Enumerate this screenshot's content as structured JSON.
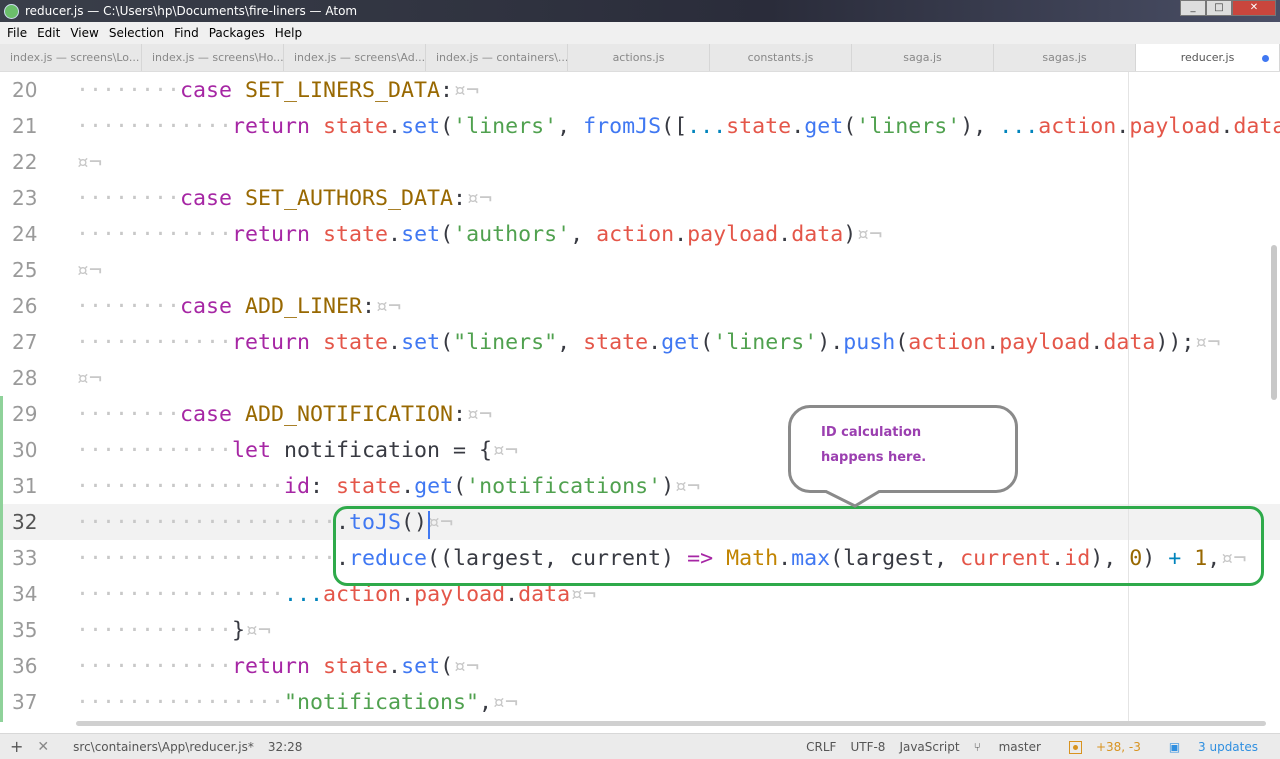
{
  "window": {
    "title": "reducer.js — C:\\Users\\hp\\Documents\\fire-liners — Atom"
  },
  "menu": [
    "File",
    "Edit",
    "View",
    "Selection",
    "Find",
    "Packages",
    "Help"
  ],
  "tabs": [
    "index.js — screens\\Lo...",
    "index.js — screens\\Ho...",
    "index.js — screens\\Ad...",
    "index.js — containers\\...",
    "actions.js",
    "constants.js",
    "saga.js",
    "sagas.js",
    "reducer.js"
  ],
  "colors": {
    "accent": "#4078f2",
    "annotation_box": "#2eaa4a",
    "annotation_text": "#9b3fb0"
  },
  "code": {
    "lines": [
      {
        "n": "20",
        "t": [
          [
            "········",
            "ws"
          ],
          [
            "case ",
            "kw"
          ],
          [
            "SET_LINERS_DATA",
            "cn"
          ],
          [
            ":",
            "pl"
          ],
          [
            "¤¬",
            "ws"
          ]
        ]
      },
      {
        "n": "21",
        "t": [
          [
            "············",
            "ws"
          ],
          [
            "return ",
            "kw"
          ],
          [
            "state",
            "vr"
          ],
          [
            ".",
            "pl"
          ],
          [
            "set",
            "fn"
          ],
          [
            "(",
            "pl"
          ],
          [
            "'liners'",
            "st"
          ],
          [
            ", ",
            "pl"
          ],
          [
            "fromJS",
            "fn"
          ],
          [
            "([",
            "pl"
          ],
          [
            "...",
            "op"
          ],
          [
            "state",
            "vr"
          ],
          [
            ".",
            "pl"
          ],
          [
            "get",
            "fn"
          ],
          [
            "(",
            "pl"
          ],
          [
            "'liners'",
            "st"
          ],
          [
            "), ",
            "pl"
          ],
          [
            "...",
            "op"
          ],
          [
            "action",
            "vr"
          ],
          [
            ".",
            "pl"
          ],
          [
            "payload",
            "vr"
          ],
          [
            ".",
            "pl"
          ],
          [
            "data",
            "vr"
          ]
        ]
      },
      {
        "n": "22",
        "t": [
          [
            "¤¬",
            "ws"
          ]
        ]
      },
      {
        "n": "23",
        "t": [
          [
            "········",
            "ws"
          ],
          [
            "case ",
            "kw"
          ],
          [
            "SET_AUTHORS_DATA",
            "cn"
          ],
          [
            ":",
            "pl"
          ],
          [
            "¤¬",
            "ws"
          ]
        ]
      },
      {
        "n": "24",
        "t": [
          [
            "············",
            "ws"
          ],
          [
            "return ",
            "kw"
          ],
          [
            "state",
            "vr"
          ],
          [
            ".",
            "pl"
          ],
          [
            "set",
            "fn"
          ],
          [
            "(",
            "pl"
          ],
          [
            "'authors'",
            "st"
          ],
          [
            ", ",
            "pl"
          ],
          [
            "action",
            "vr"
          ],
          [
            ".",
            "pl"
          ],
          [
            "payload",
            "vr"
          ],
          [
            ".",
            "pl"
          ],
          [
            "data",
            "vr"
          ],
          [
            ")",
            "pl"
          ],
          [
            "¤¬",
            "ws"
          ]
        ]
      },
      {
        "n": "25",
        "t": [
          [
            "¤¬",
            "ws"
          ]
        ]
      },
      {
        "n": "26",
        "t": [
          [
            "········",
            "ws"
          ],
          [
            "case ",
            "kw"
          ],
          [
            "ADD_LINER",
            "cn"
          ],
          [
            ":",
            "pl"
          ],
          [
            "¤¬",
            "ws"
          ]
        ]
      },
      {
        "n": "27",
        "t": [
          [
            "············",
            "ws"
          ],
          [
            "return ",
            "kw"
          ],
          [
            "state",
            "vr"
          ],
          [
            ".",
            "pl"
          ],
          [
            "set",
            "fn"
          ],
          [
            "(",
            "pl"
          ],
          [
            "\"liners\"",
            "st"
          ],
          [
            ", ",
            "pl"
          ],
          [
            "state",
            "vr"
          ],
          [
            ".",
            "pl"
          ],
          [
            "get",
            "fn"
          ],
          [
            "(",
            "pl"
          ],
          [
            "'liners'",
            "st"
          ],
          [
            ").",
            "pl"
          ],
          [
            "push",
            "fn"
          ],
          [
            "(",
            "pl"
          ],
          [
            "action",
            "vr"
          ],
          [
            ".",
            "pl"
          ],
          [
            "payload",
            "vr"
          ],
          [
            ".",
            "pl"
          ],
          [
            "data",
            "vr"
          ],
          [
            "));",
            "pl"
          ],
          [
            "¤¬",
            "ws"
          ]
        ]
      },
      {
        "n": "28",
        "t": [
          [
            "¤¬",
            "ws"
          ]
        ]
      },
      {
        "n": "29",
        "t": [
          [
            "········",
            "ws"
          ],
          [
            "case ",
            "kw"
          ],
          [
            "ADD_NOTIFICATION",
            "cn"
          ],
          [
            ":",
            "pl"
          ],
          [
            "¤¬",
            "ws"
          ]
        ]
      },
      {
        "n": "30",
        "t": [
          [
            "············",
            "ws"
          ],
          [
            "let ",
            "kw"
          ],
          [
            "notification = {",
            "pl"
          ],
          [
            "¤¬",
            "ws"
          ]
        ]
      },
      {
        "n": "31",
        "t": [
          [
            "················",
            "ws"
          ],
          [
            "id",
            "kw"
          ],
          [
            ": ",
            "pl"
          ],
          [
            "state",
            "vr"
          ],
          [
            ".",
            "pl"
          ],
          [
            "get",
            "fn"
          ],
          [
            "(",
            "pl"
          ],
          [
            "'notifications'",
            "st"
          ],
          [
            ")",
            "pl"
          ],
          [
            "¤¬",
            "ws"
          ]
        ]
      },
      {
        "n": "32",
        "t": [
          [
            "····················",
            "ws"
          ],
          [
            ".",
            "pl"
          ],
          [
            "toJS",
            "fn"
          ],
          [
            "()",
            "pl"
          ],
          [
            "¤¬",
            "ws"
          ]
        ]
      },
      {
        "n": "33",
        "t": [
          [
            "····················",
            "ws"
          ],
          [
            ".",
            "pl"
          ],
          [
            "reduce",
            "fn"
          ],
          [
            "((largest, current) ",
            "pl"
          ],
          [
            "=>",
            "kw"
          ],
          [
            " ",
            "pl"
          ],
          [
            "Math",
            "cl"
          ],
          [
            ".",
            "pl"
          ],
          [
            "max",
            "fn"
          ],
          [
            "(largest, ",
            "pl"
          ],
          [
            "current",
            "vr"
          ],
          [
            ".",
            "pl"
          ],
          [
            "id",
            "vr"
          ],
          [
            "), ",
            "pl"
          ],
          [
            "0",
            "cn"
          ],
          [
            ") ",
            "pl"
          ],
          [
            "+",
            "op"
          ],
          [
            " ",
            "pl"
          ],
          [
            "1",
            "cn"
          ],
          [
            ",",
            "pl"
          ],
          [
            "¤¬",
            "ws"
          ]
        ]
      },
      {
        "n": "34",
        "t": [
          [
            "················",
            "ws"
          ],
          [
            "...",
            "op"
          ],
          [
            "action",
            "vr"
          ],
          [
            ".",
            "pl"
          ],
          [
            "payload",
            "vr"
          ],
          [
            ".",
            "pl"
          ],
          [
            "data",
            "vr"
          ],
          [
            "¤¬",
            "ws"
          ]
        ]
      },
      {
        "n": "35",
        "t": [
          [
            "············",
            "ws"
          ],
          [
            "}",
            "pl"
          ],
          [
            "¤¬",
            "ws"
          ]
        ]
      },
      {
        "n": "36",
        "t": [
          [
            "············",
            "ws"
          ],
          [
            "return ",
            "kw"
          ],
          [
            "state",
            "vr"
          ],
          [
            ".",
            "pl"
          ],
          [
            "set",
            "fn"
          ],
          [
            "(",
            "pl"
          ],
          [
            "¤¬",
            "ws"
          ]
        ]
      },
      {
        "n": "37",
        "t": [
          [
            "················",
            "ws"
          ],
          [
            "\"notifications\"",
            "st"
          ],
          [
            ",",
            "pl"
          ],
          [
            "¤¬",
            "ws"
          ]
        ]
      }
    ]
  },
  "annotation": {
    "text": "ID calculation happens here."
  },
  "status": {
    "path": "src\\containers\\App\\reducer.js*",
    "cursor": "32:28",
    "line_ending": "CRLF",
    "encoding": "UTF-8",
    "grammar": "JavaScript",
    "branch": "master",
    "diff": "+38, -3",
    "updates": "3 updates"
  }
}
